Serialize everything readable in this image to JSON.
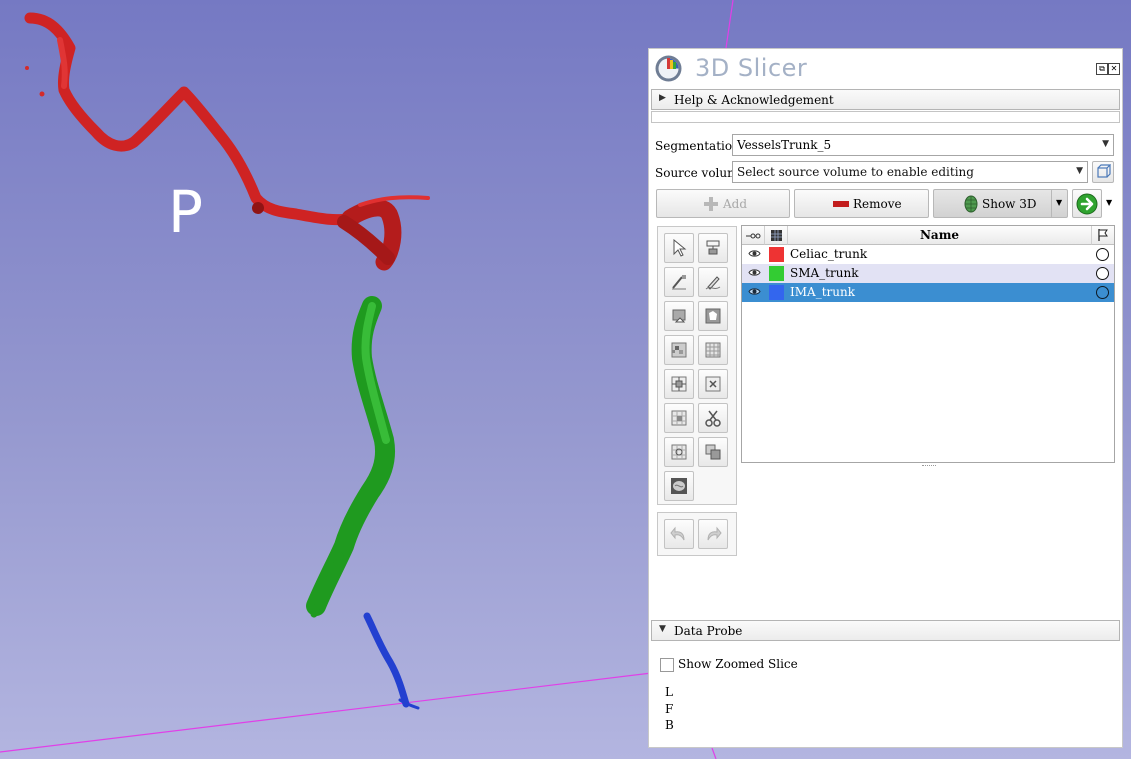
{
  "viewport": {
    "orientation_label": "P",
    "segments_3d": [
      {
        "name": "Celiac_trunk",
        "color": "#d92b2b"
      },
      {
        "name": "SMA_trunk",
        "color": "#28a628"
      },
      {
        "name": "IMA_trunk",
        "color": "#2a47d6"
      }
    ]
  },
  "panel": {
    "app_title": "3D Slicer",
    "help_section": "Help & Acknowledgement",
    "segmentation_label": "Segmentation:",
    "segmentation_value": "VesselsTrunk_5",
    "source_volume_label": "Source volume:",
    "source_volume_placeholder": "Select source volume to enable editing",
    "add_label": "Add",
    "remove_label": "Remove",
    "show3d_label": "Show 3D",
    "table": {
      "columns": [
        "",
        "",
        "Name",
        ""
      ],
      "rows": [
        {
          "name": "Celiac_trunk",
          "color": "#ee3333",
          "selected": false
        },
        {
          "name": "SMA_trunk",
          "color": "#33cc33",
          "selected": false
        },
        {
          "name": "IMA_trunk",
          "color": "#3366ee",
          "selected": true
        }
      ]
    },
    "data_probe": {
      "title": "Data Probe",
      "show_zoomed_slice_label": "Show Zoomed Slice",
      "show_zoomed_slice_checked": false,
      "lines": [
        "L",
        "F",
        "B"
      ]
    }
  }
}
